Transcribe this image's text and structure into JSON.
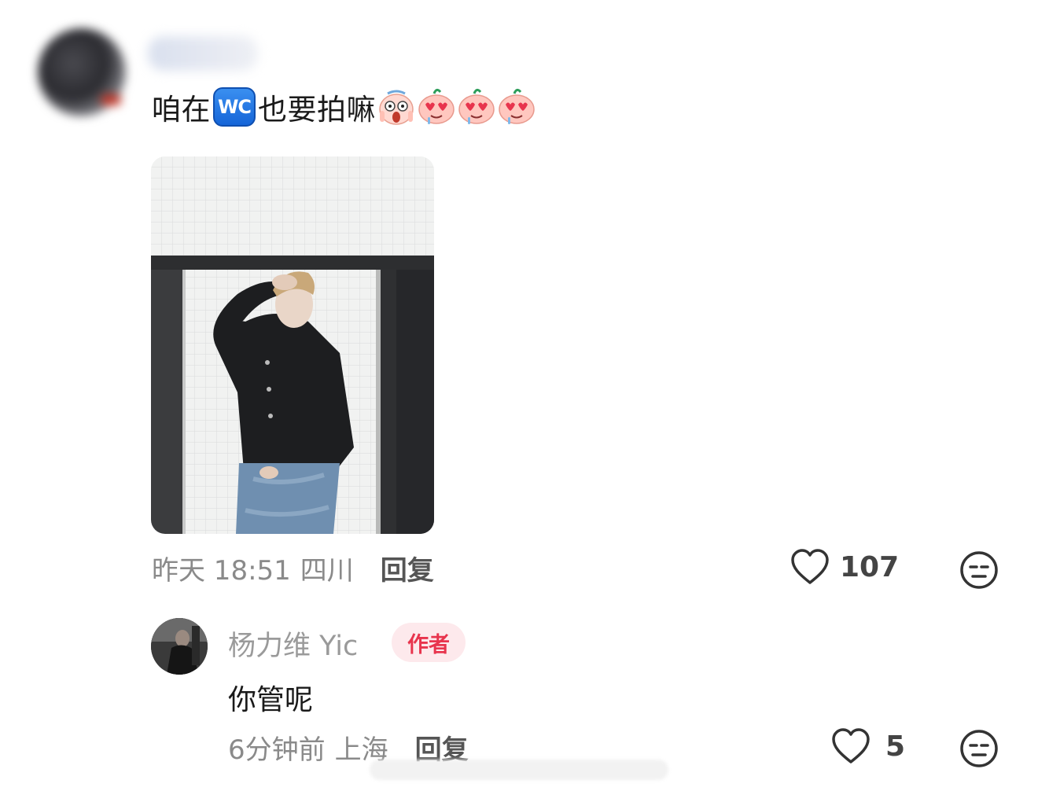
{
  "main_comment": {
    "text_before": "咱在",
    "badge": "WC",
    "text_after": "也要拍嘛",
    "emojis": [
      "scream-emoji",
      "heart-eyes-drool-emoji",
      "heart-eyes-drool-emoji",
      "heart-eyes-drool-emoji"
    ],
    "time": "昨天 18:51",
    "location": "四川",
    "reply_label": "回复",
    "likes": "107"
  },
  "reply_comment": {
    "username": "杨力维 Yic",
    "badge": "作者",
    "text": "你管呢",
    "time": "6分钟前",
    "location": "上海",
    "reply_label": "回复",
    "likes": "5"
  },
  "colors": {
    "author_badge_bg": "#fde9ec",
    "author_badge_text": "#e8344d",
    "wc_badge": "#1565d8"
  }
}
